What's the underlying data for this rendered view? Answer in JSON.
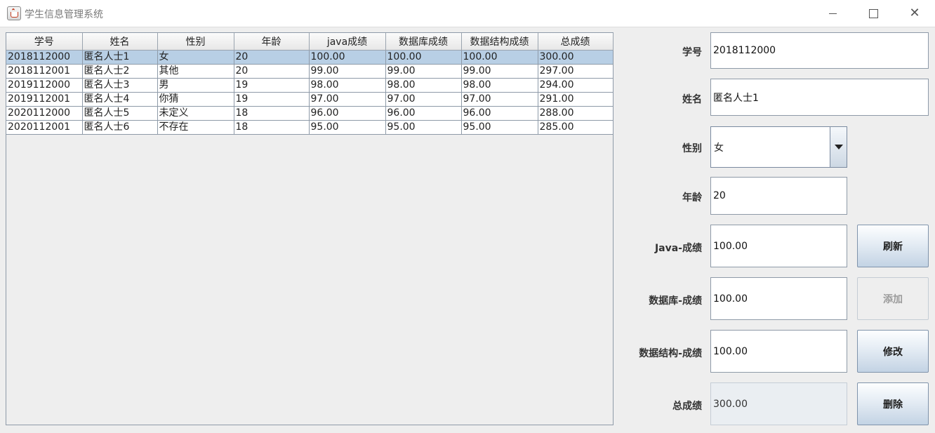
{
  "window": {
    "title": "学生信息管理系统"
  },
  "table": {
    "columns": [
      "学号",
      "姓名",
      "性别",
      "年龄",
      "java成绩",
      "数据库成绩",
      "数据结构成绩",
      "总成绩"
    ],
    "rows": [
      [
        "2018112000",
        "匿名人士1",
        "女",
        "20",
        "100.00",
        "100.00",
        "100.00",
        "300.00"
      ],
      [
        "2018112001",
        "匿名人士2",
        "其他",
        "20",
        "99.00",
        "99.00",
        "99.00",
        "297.00"
      ],
      [
        "2019112000",
        "匿名人士3",
        "男",
        "19",
        "98.00",
        "98.00",
        "98.00",
        "294.00"
      ],
      [
        "2019112001",
        "匿名人士4",
        "你猜",
        "19",
        "97.00",
        "97.00",
        "97.00",
        "291.00"
      ],
      [
        "2020112000",
        "匿名人士5",
        "未定义",
        "18",
        "96.00",
        "96.00",
        "96.00",
        "288.00"
      ],
      [
        "2020112001",
        "匿名人士6",
        "不存在",
        "18",
        "95.00",
        "95.00",
        "95.00",
        "285.00"
      ]
    ],
    "selected_row": 0
  },
  "form": {
    "id_label": "学号",
    "id_value": "2018112000",
    "name_label": "姓名",
    "name_value": "匿名人士1",
    "gender_label": "性别",
    "gender_value": "女",
    "age_label": "年龄",
    "age_value": "20",
    "java_label": "Java-成绩",
    "java_value": "100.00",
    "db_label": "数据库-成绩",
    "db_value": "100.00",
    "ds_label": "数据结构-成绩",
    "ds_value": "100.00",
    "total_label": "总成绩",
    "total_value": "300.00"
  },
  "buttons": {
    "refresh": "刷新",
    "add": "添加",
    "modify": "修改",
    "delete": "删除"
  },
  "icons": {
    "app": "java-cup-icon",
    "minimize": "minimize-icon",
    "maximize": "maximize-icon",
    "close": "close-icon",
    "dropdown": "chevron-down-icon"
  },
  "colors": {
    "selected_row": "#b8cfe5",
    "button_gradient_bottom": "#c3d3e4"
  }
}
